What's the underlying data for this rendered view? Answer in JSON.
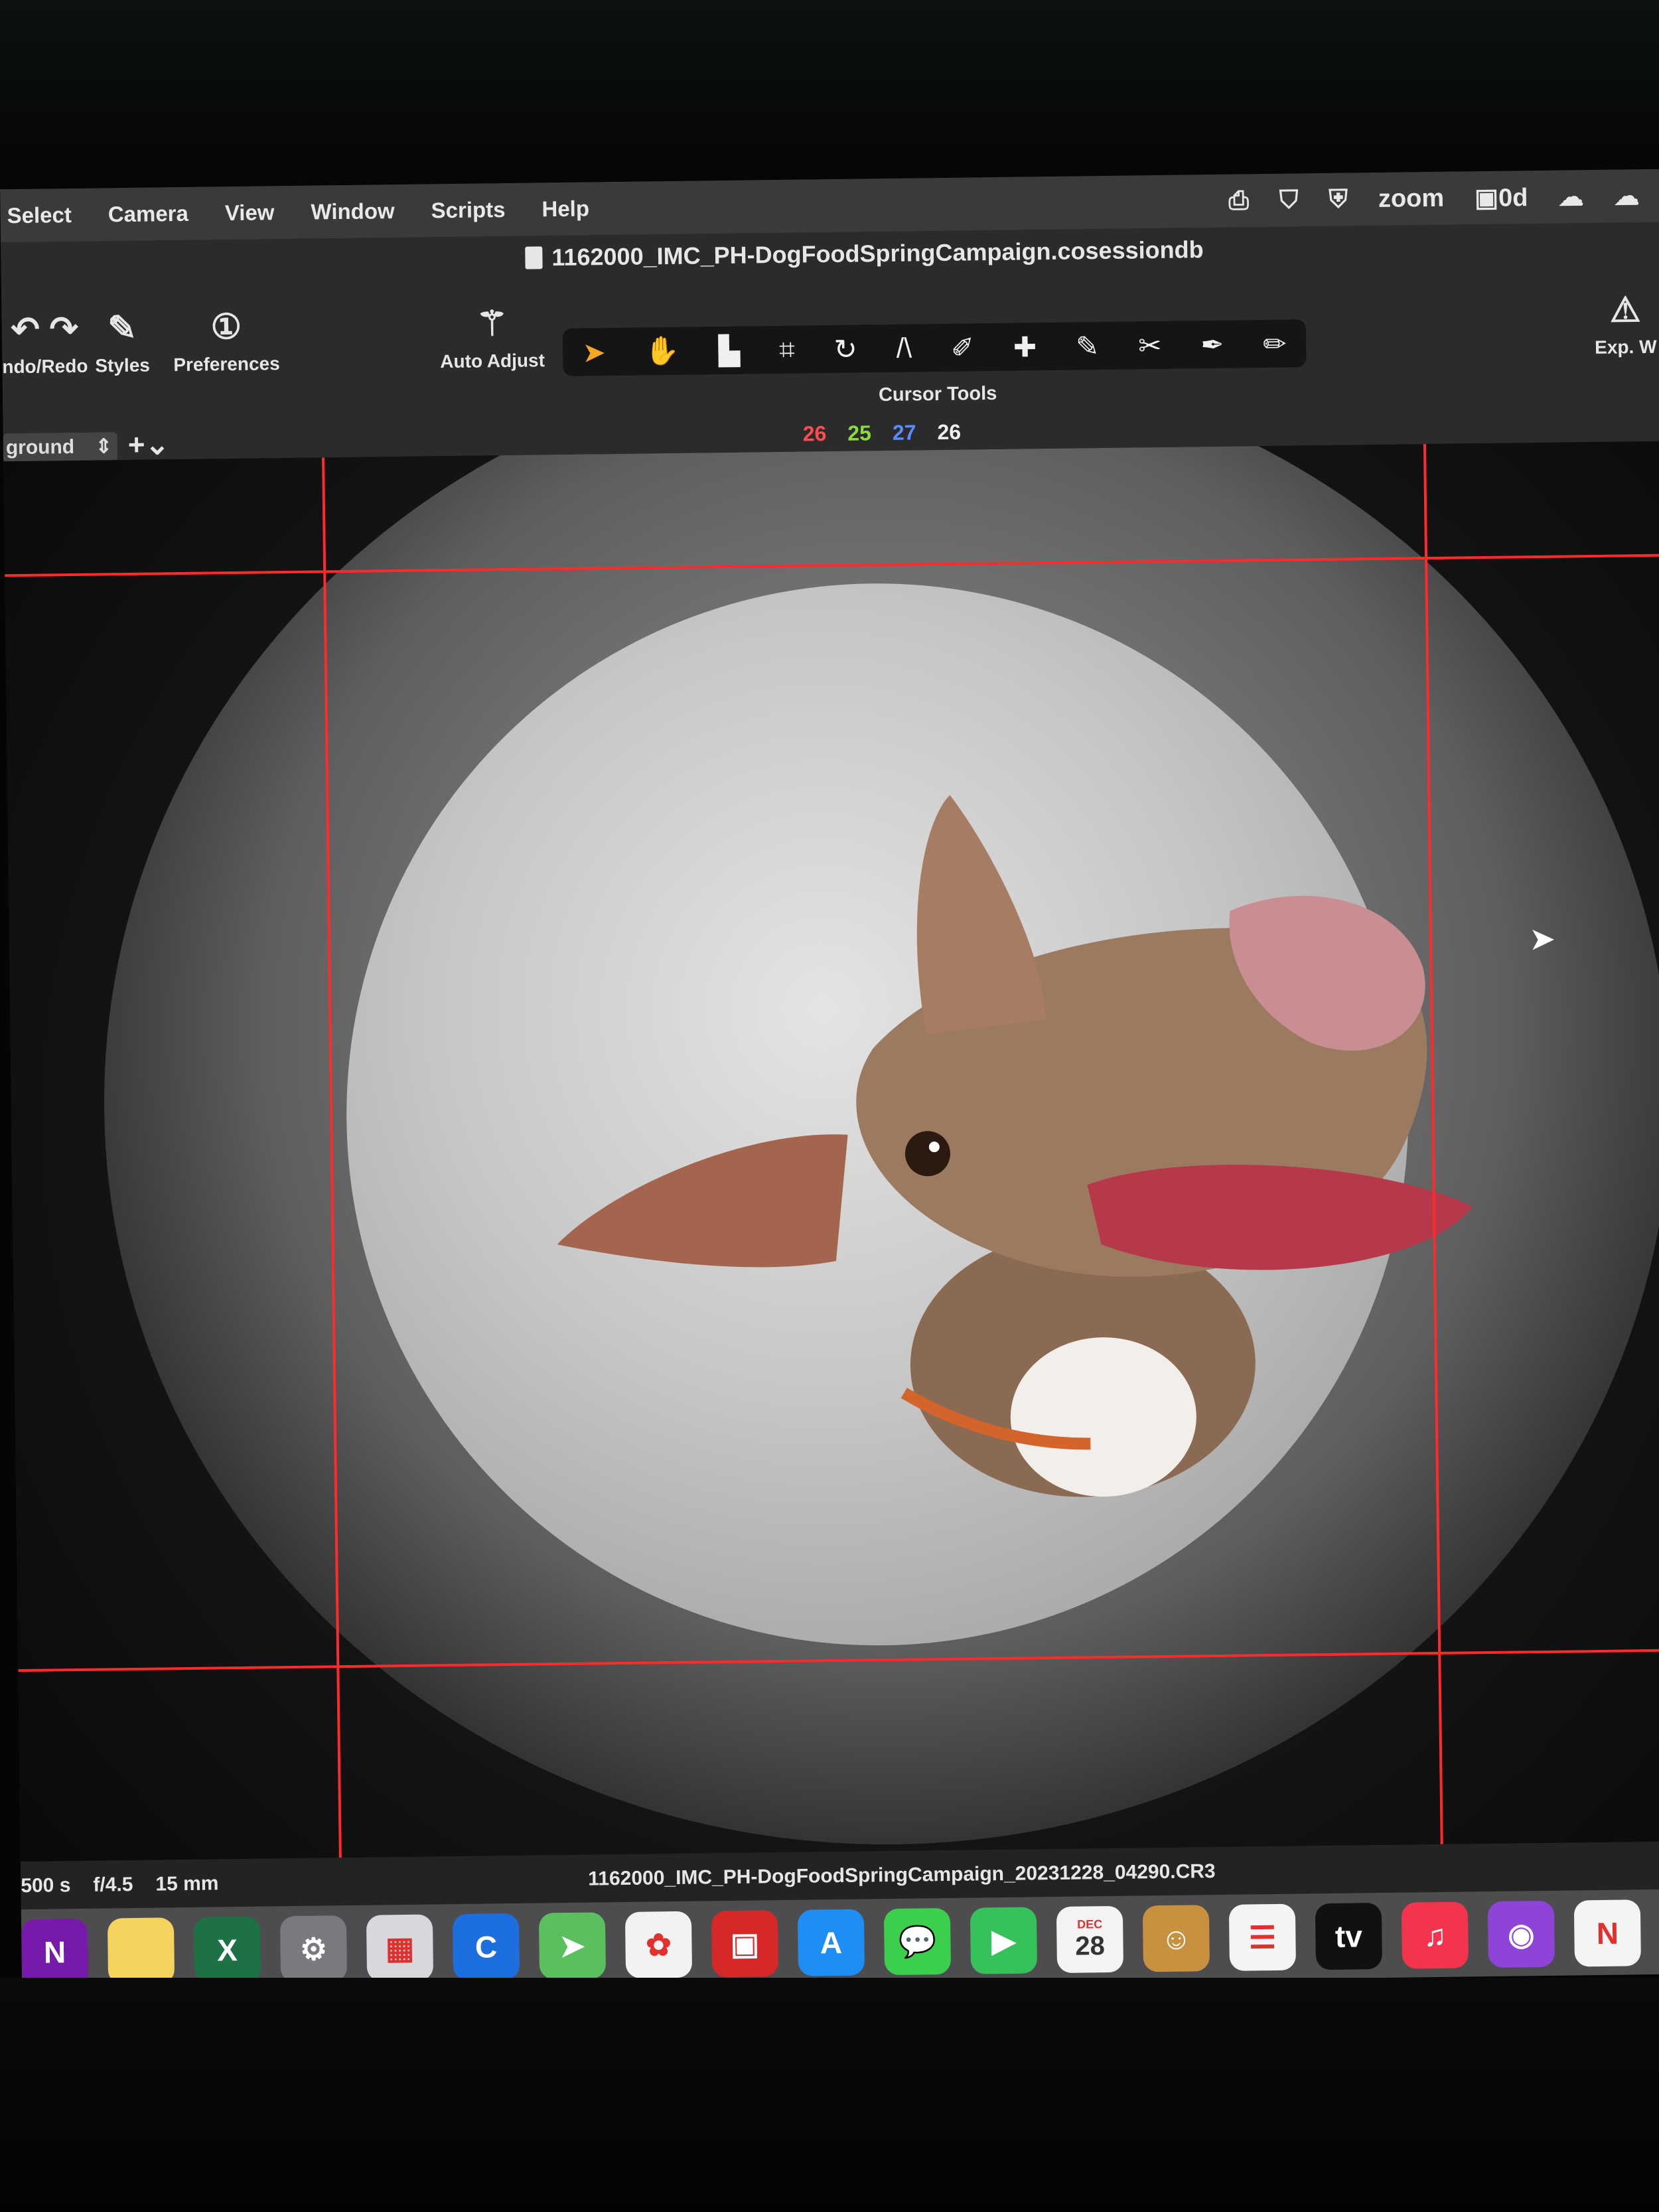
{
  "menubar": {
    "items": [
      "Select",
      "Camera",
      "View",
      "Window",
      "Scripts",
      "Help"
    ],
    "status_zoom": "zoom",
    "status_timer": "0d"
  },
  "document": {
    "title": "1162000_IMC_PH-DogFoodSpringCampaign.cosessiondb"
  },
  "toolbar": {
    "undo_redo_label": "ndo/Redo",
    "styles_label": "Styles",
    "preferences_label": "Preferences",
    "auto_adjust_label": "Auto Adjust",
    "cursor_tools_label": "Cursor Tools",
    "exp_label": "Exp. W"
  },
  "counts": {
    "red": "26",
    "green": "25",
    "blue": "27",
    "white": "26"
  },
  "layer_select": {
    "value": "ground"
  },
  "info_bar": {
    "shutter": "500 s",
    "aperture": "f/4.5",
    "focal_length": "15 mm",
    "filename": "1162000_IMC_PH-DogFoodSpringCampaign_20231228_04290.CR3"
  },
  "dock": {
    "icons": [
      {
        "name": "onenote-icon",
        "glyph": "N",
        "color": "#7719aa"
      },
      {
        "name": "notes-icon",
        "glyph": "",
        "color": "#f4d35e"
      },
      {
        "name": "excel-icon",
        "glyph": "X",
        "color": "#1e7145"
      },
      {
        "name": "system-settings-icon",
        "glyph": "⚙",
        "color": "#7a7a7e"
      },
      {
        "name": "launchpad-icon",
        "glyph": "▦",
        "color": "#d8d8dc"
      },
      {
        "name": "capture-one-icon",
        "glyph": "C",
        "color": "#1d6fe0"
      },
      {
        "name": "maps-icon",
        "glyph": "➤",
        "color": "#5bbf60"
      },
      {
        "name": "photos-icon",
        "glyph": "✿",
        "color": "#f2f2f2"
      },
      {
        "name": "photo-booth-icon",
        "glyph": "▣",
        "color": "#d62828"
      },
      {
        "name": "app-store-icon",
        "glyph": "A",
        "color": "#1e8ef5"
      },
      {
        "name": "messages-icon",
        "glyph": "💬",
        "color": "#3ccf4e"
      },
      {
        "name": "facetime-icon",
        "glyph": "▶",
        "color": "#37c15a"
      },
      {
        "name": "calendar-icon",
        "glyph": "28",
        "color": "#f4f4f4"
      },
      {
        "name": "contacts-icon",
        "glyph": "☺",
        "color": "#c9903f"
      },
      {
        "name": "reminders-icon",
        "glyph": "☰",
        "color": "#f4f4f4"
      },
      {
        "name": "apple-tv-icon",
        "glyph": "tv",
        "color": "#111111"
      },
      {
        "name": "music-icon",
        "glyph": "♫",
        "color": "#f2344d"
      },
      {
        "name": "podcasts-icon",
        "glyph": "◉",
        "color": "#8e44d6"
      },
      {
        "name": "news-icon",
        "glyph": "N",
        "color": "#f4f4f4"
      },
      {
        "name": "keynote-icon",
        "glyph": "▲",
        "color": "#1d8fe0"
      }
    ],
    "calendar_month": "DEC",
    "calendar_day": "28"
  }
}
